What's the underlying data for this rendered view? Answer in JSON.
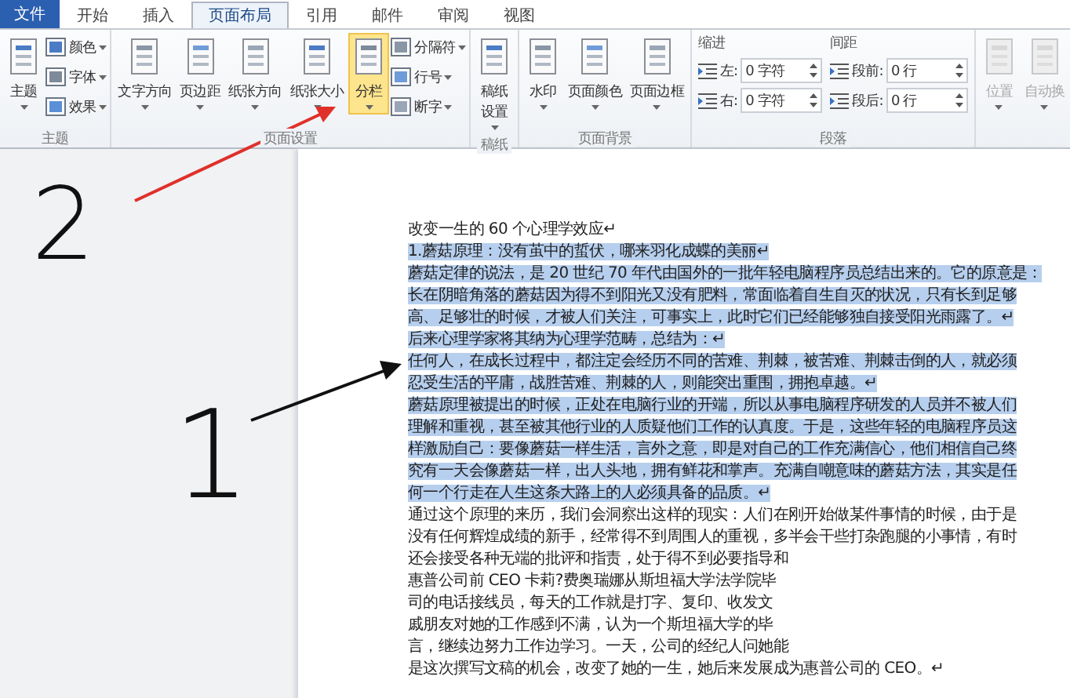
{
  "tabs": [
    {
      "label": "文件",
      "kind": "file"
    },
    {
      "label": "开始",
      "kind": "tab",
      "selected": false
    },
    {
      "label": "插入",
      "kind": "tab",
      "selected": false
    },
    {
      "label": "页面布局",
      "kind": "tab",
      "selected": true
    },
    {
      "label": "引用",
      "kind": "tab",
      "selected": false
    },
    {
      "label": "邮件",
      "kind": "tab",
      "selected": false
    },
    {
      "label": "审阅",
      "kind": "tab",
      "selected": false
    },
    {
      "label": "视图",
      "kind": "tab",
      "selected": false
    }
  ],
  "ribbon": {
    "groups": [
      {
        "label": "主题",
        "columns": [
          {
            "items": [
              {
                "kind": "large",
                "label": "主题",
                "selected": false
              }
            ]
          },
          {
            "items": [
              {
                "kind": "small",
                "label": "颜色"
              },
              {
                "kind": "small",
                "label": "字体"
              },
              {
                "kind": "small",
                "label": "效果"
              }
            ]
          }
        ]
      },
      {
        "label": "页面设置",
        "columns": [
          {
            "items": [
              {
                "kind": "large",
                "label": "文字方向",
                "selected": false
              }
            ]
          },
          {
            "items": [
              {
                "kind": "large",
                "label": "页边距",
                "selected": false
              }
            ]
          },
          {
            "items": [
              {
                "kind": "large",
                "label": "纸张方向",
                "selected": false
              }
            ]
          },
          {
            "items": [
              {
                "kind": "large",
                "label": "纸张大小",
                "selected": false
              }
            ]
          },
          {
            "items": [
              {
                "kind": "large",
                "label": "分栏",
                "selected": true
              }
            ]
          },
          {
            "items": [
              {
                "kind": "small",
                "label": "分隔符"
              },
              {
                "kind": "small",
                "label": "行号"
              },
              {
                "kind": "small",
                "label": "断字"
              }
            ]
          }
        ]
      },
      {
        "label": "稿纸",
        "columns": [
          {
            "items": [
              {
                "kind": "large",
                "label": "稿纸设置",
                "selected": false
              }
            ]
          }
        ]
      },
      {
        "label": "页面背景",
        "columns": [
          {
            "items": [
              {
                "kind": "large",
                "label": "水印",
                "selected": false
              }
            ]
          },
          {
            "items": [
              {
                "kind": "large",
                "label": "页面颜色",
                "selected": false
              }
            ]
          },
          {
            "items": [
              {
                "kind": "large",
                "label": "页面边框",
                "selected": false
              }
            ]
          }
        ]
      },
      {
        "label": "段落",
        "columns": [
          {
            "heading": "缩进",
            "items": [
              {
                "kind": "spin",
                "label": "左:",
                "value": "0 字符"
              },
              {
                "kind": "spin",
                "label": "右:",
                "value": "0 字符"
              }
            ]
          },
          {
            "heading": "间距",
            "items": [
              {
                "kind": "spin",
                "label": "段前:",
                "value": "0 行"
              },
              {
                "kind": "spin",
                "label": "段后:",
                "value": "0 行"
              }
            ]
          }
        ]
      },
      {
        "columns": [
          {
            "items": [
              {
                "kind": "large",
                "label": "位置",
                "selected": false,
                "disabled": true
              }
            ]
          },
          {
            "items": [
              {
                "kind": "large",
                "label": "自动换",
                "selected": false,
                "disabled": true
              }
            ]
          }
        ]
      }
    ]
  },
  "annotations": [
    {
      "text": "2",
      "color": "#111111"
    },
    {
      "text": "1",
      "color": "#111111"
    }
  ],
  "arrows": [
    {
      "color": "#e0302a"
    },
    {
      "color": "#111111"
    }
  ],
  "document": {
    "lines": [
      {
        "text": "改变一生的 60 个心理学效应↵",
        "selected": false
      },
      {
        "text": "1.蘑菇原理：没有茧中的蜇伏，哪来羽化成蝶的美丽↵",
        "selected": true
      },
      {
        "text": "蘑菇定律的说法，是 20 世纪 70 年代由国外的一批年轻电脑程序员总结出来的。它的原意是：",
        "selected": true
      },
      {
        "text": "长在阴暗角落的蘑菇因为得不到阳光又没有肥料，常面临着自生自灭的状况，只有长到足够",
        "selected": true
      },
      {
        "text": "高、足够壮的时候，才被人们关注，可事实上，此时它们已经能够独自接受阳光雨露了。↵",
        "selected": true
      },
      {
        "text": "后来心理学家将其纳为心理学范畴，总结为：↵",
        "selected": true
      },
      {
        "text": "任何人，在成长过程中，都注定会经历不同的苦难、荆棘，被苦难、荆棘击倒的人，就必须",
        "selected": true
      },
      {
        "text": "忍受生活的平庸，战胜苦难、荆棘的人，则能突出重围，拥抱卓越。↵",
        "selected": true
      },
      {
        "text": "蘑菇原理被提出的时候，正处在电脑行业的开端，所以从事电脑程序研发的人员并不被人们",
        "selected": true
      },
      {
        "text": "理解和重视，甚至被其他行业的人质疑他们工作的认真度。于是，这些年轻的电脑程序员这",
        "selected": true
      },
      {
        "text": "样激励自己：要像蘑菇一样生活，言外之意，即是对自己的工作充满信心，他们相信自己终",
        "selected": true
      },
      {
        "text": "究有一天会像蘑菇一样，出人头地，拥有鲜花和掌声。充满自嘲意味的蘑菇方法，其实是任",
        "selected": true
      },
      {
        "text": "何一个行走在人生这条大路上的人必须具备的品质。↵",
        "selected": true
      },
      {
        "text": "通过这个原理的来历，我们会洞察出这样的现实：人们在刚开始做某件事情的时候，由于是",
        "selected": false
      },
      {
        "text": "没有任何辉煌成绩的新手，经常得不到周围人的重视，多半会干些打杂跑腿的小事情，有时",
        "selected": false
      },
      {
        "text": "还会接受各种无端的批评和指责，处于得不到必要指导和",
        "selected": false
      },
      {
        "text": "惠普公司前 CEO 卡莉?费奥瑞娜从斯坦福大学法学院毕",
        "selected": false
      },
      {
        "text": "司的电话接线员，每天的工作就是打字、复印、收发文",
        "selected": false
      },
      {
        "text": "戚朋友对她的工作感到不满，认为一个斯坦福大学的毕",
        "selected": false
      },
      {
        "text": "言，继续边努力工作边学习。一天，公司的经纪人问她能",
        "selected": false
      },
      {
        "text": "是这次撰写文稿的机会，改变了她的一生，她后来发展成为惠普公司的 CEO。↵",
        "selected": false
      }
    ]
  }
}
